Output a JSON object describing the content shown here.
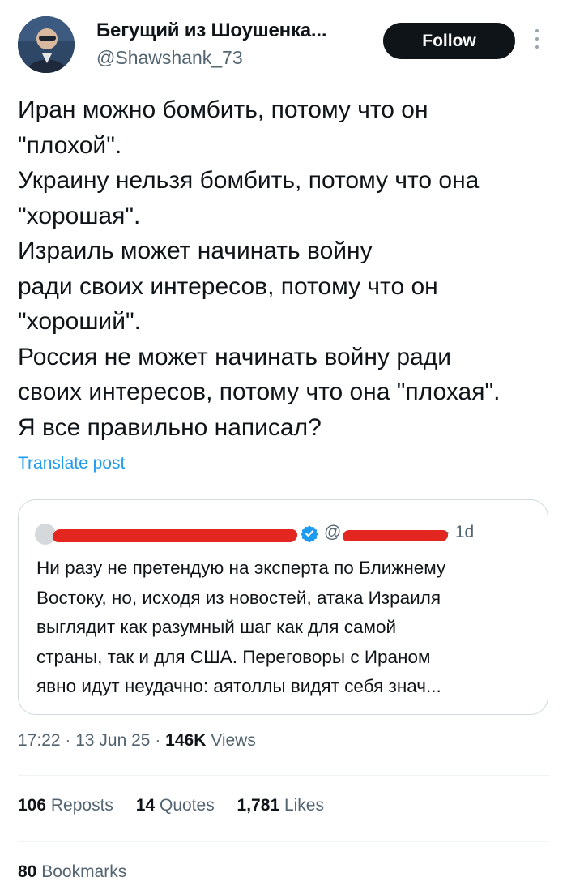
{
  "author": {
    "display_name": "Бегущий из Шоушенка...",
    "handle": "@Shawshank_73",
    "follow_label": "Follow",
    "avatar_icon": "user-avatar"
  },
  "tweet": {
    "text": "Иран можно бомбить, потому что он\n\"плохой\".\nУкраину нельзя бомбить, потому что она\n\"хорошая\".\nИзраиль может начинать войну\nради своих интересов, потому что он\n\"хороший\".\nРоссия не может начинать войну ради\nсвоих интересов, потому что она \"плохая\".\nЯ все правильно написал?",
    "translate_label": "Translate post"
  },
  "quote": {
    "at_sign": "@",
    "time_label": "· 1d",
    "text": "Ни разу не претендую на эксперта по Ближнему\nВостоку, но, исходя из новостей, атака Израиля\nвыглядит как разумный шаг как для самой\nстраны, так и для США. Переговоры с Ираном\nявно идут неудачно: аятоллы видят себя знач..."
  },
  "meta": {
    "time": "17:22",
    "date": "13 Jun 25",
    "views_count": "146K",
    "views_label": "Views"
  },
  "stats": {
    "reposts_count": "106",
    "reposts_label": "Reposts",
    "quotes_count": "14",
    "quotes_label": "Quotes",
    "likes_count": "1,781",
    "likes_label": "Likes",
    "bookmarks_count": "80",
    "bookmarks_label": "Bookmarks"
  },
  "colors": {
    "link_blue": "#1d9bf0",
    "text_primary": "#0f1419",
    "text_secondary": "#536471",
    "redaction_red": "#e32620",
    "button_bg": "#0f1419"
  }
}
